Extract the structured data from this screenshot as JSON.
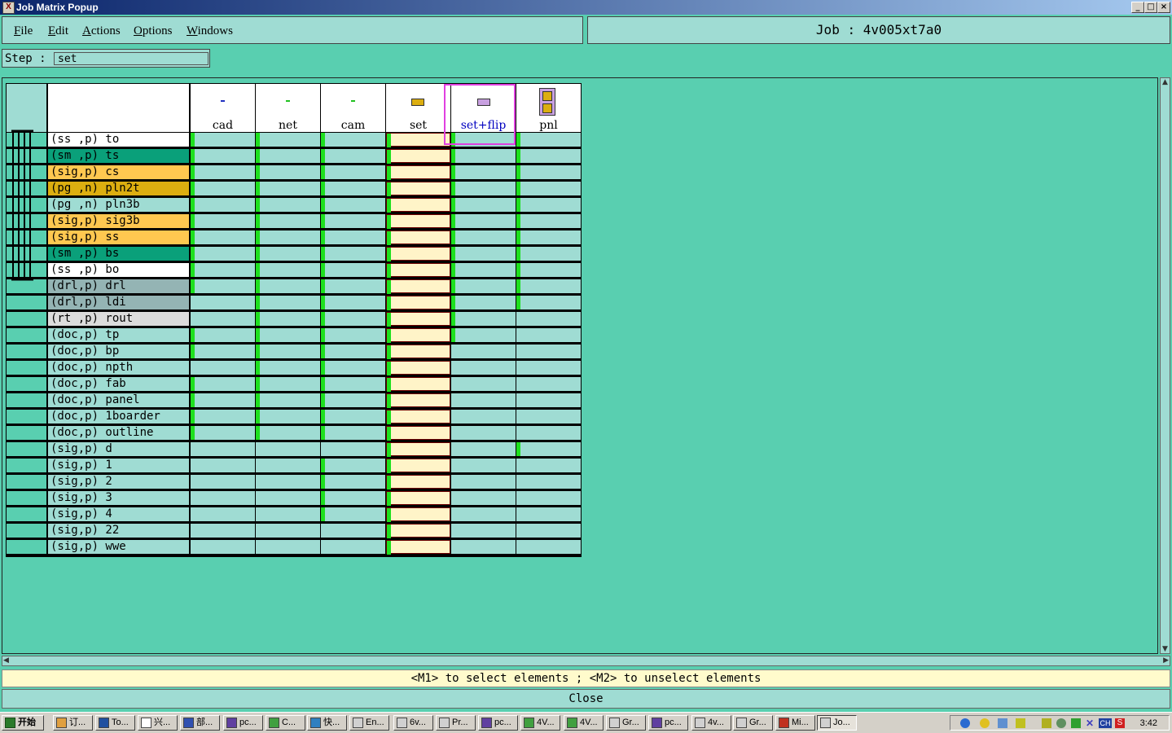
{
  "window": {
    "title": "Job Matrix Popup",
    "minimize": "_",
    "maximize": "□",
    "close": "×"
  },
  "menu": [
    "File",
    "Edit",
    "Actions",
    "Options",
    "Windows"
  ],
  "job": {
    "label": "Job",
    "sep": ":",
    "name": "4v005xt7a0"
  },
  "step": {
    "label": "Step :",
    "value": "set"
  },
  "columns": [
    {
      "name": "cad",
      "icon": "cad-step-icon"
    },
    {
      "name": "net",
      "icon": "net-step-icon"
    },
    {
      "name": "cam",
      "icon": "cam-step-icon"
    },
    {
      "name": "set",
      "icon": "set-step-icon"
    },
    {
      "name": "set+flip",
      "icon": "set-flip-step-icon"
    },
    {
      "name": "pnl",
      "icon": "pnl-step-icon"
    }
  ],
  "rows": [
    {
      "label": "(ss ,p) to",
      "type": "silk",
      "cells": [
        1,
        1,
        1,
        1,
        1,
        1
      ]
    },
    {
      "label": "(sm ,p) ts",
      "type": "mask",
      "cells": [
        1,
        1,
        1,
        1,
        1,
        1
      ]
    },
    {
      "label": "(sig,p) cs",
      "type": "signal",
      "cells": [
        1,
        1,
        1,
        1,
        1,
        1
      ]
    },
    {
      "label": "(pg ,n) pln2t",
      "type": "plane",
      "cells": [
        1,
        1,
        1,
        1,
        1,
        1
      ]
    },
    {
      "label": "(pg ,n) pln3b",
      "type": "plain",
      "cells": [
        1,
        1,
        1,
        1,
        1,
        1
      ]
    },
    {
      "label": "(sig,p) sig3b",
      "type": "signal",
      "cells": [
        1,
        1,
        1,
        1,
        1,
        1
      ]
    },
    {
      "label": "(sig,p) ss",
      "type": "signal",
      "cells": [
        1,
        1,
        1,
        1,
        1,
        1
      ]
    },
    {
      "label": "(sm ,p) bs",
      "type": "mask",
      "cells": [
        1,
        1,
        1,
        1,
        1,
        1
      ]
    },
    {
      "label": "(ss ,p) bo",
      "type": "silk",
      "cells": [
        1,
        1,
        1,
        1,
        1,
        1
      ]
    },
    {
      "label": "(drl,p) drl",
      "type": "drill",
      "cells": [
        1,
        1,
        1,
        1,
        1,
        1
      ]
    },
    {
      "label": "(drl,p) ldi",
      "type": "drill",
      "cells": [
        0,
        1,
        1,
        1,
        1,
        1
      ]
    },
    {
      "label": "(rt ,p) rout",
      "type": "rout",
      "cells": [
        0,
        1,
        1,
        1,
        1,
        0
      ]
    },
    {
      "label": "(doc,p) tp",
      "type": "plain",
      "cells": [
        1,
        1,
        1,
        1,
        1,
        0
      ]
    },
    {
      "label": "(doc,p) bp",
      "type": "plain",
      "cells": [
        1,
        1,
        1,
        1,
        0,
        0
      ]
    },
    {
      "label": "(doc,p) npth",
      "type": "plain",
      "cells": [
        0,
        1,
        1,
        1,
        0,
        0
      ]
    },
    {
      "label": "(doc,p) fab",
      "type": "plain",
      "cells": [
        1,
        1,
        1,
        1,
        0,
        0
      ]
    },
    {
      "label": "(doc,p) panel",
      "type": "plain",
      "cells": [
        1,
        1,
        1,
        1,
        0,
        0
      ]
    },
    {
      "label": "(doc,p) 1boarder",
      "type": "plain",
      "cells": [
        1,
        1,
        1,
        1,
        0,
        0
      ]
    },
    {
      "label": "(doc,p) outline",
      "type": "plain",
      "cells": [
        1,
        1,
        1,
        1,
        0,
        0
      ]
    },
    {
      "label": "(sig,p) d",
      "type": "plain",
      "cells": [
        0,
        0,
        0,
        1,
        0,
        1
      ]
    },
    {
      "label": "(sig,p) 1",
      "type": "plain",
      "cells": [
        0,
        0,
        1,
        1,
        0,
        0
      ]
    },
    {
      "label": "(sig,p) 2",
      "type": "plain",
      "cells": [
        0,
        0,
        1,
        1,
        0,
        0
      ]
    },
    {
      "label": "(sig,p) 3",
      "type": "plain",
      "cells": [
        0,
        0,
        1,
        1,
        0,
        0
      ]
    },
    {
      "label": "(sig,p) 4",
      "type": "plain",
      "cells": [
        0,
        0,
        1,
        1,
        0,
        0
      ]
    },
    {
      "label": "(sig,p) 22",
      "type": "plain",
      "cells": [
        0,
        0,
        0,
        1,
        0,
        0
      ]
    },
    {
      "label": "(sig,p) wwe",
      "type": "plain",
      "cells": [
        0,
        0,
        0,
        1,
        0,
        0
      ]
    }
  ],
  "colors": {
    "silk": "#ffffff",
    "mask": "#0aa07a",
    "signal": "#ffc850",
    "plane": "#dcae10",
    "drill": "#94b4b4",
    "rout": "#dcdcdc",
    "plain": "#9fdcd3",
    "active": "#1ee01e",
    "grid": "#9fdcd3",
    "set": "#fff4c8",
    "selection": "#e040e0"
  },
  "status": "<M1> to select elements ; <M2> to unselect elements",
  "close_label": "Close",
  "taskbar": {
    "start": "开始",
    "items": [
      "订...",
      "To...",
      "兴...",
      "部...",
      "pc...",
      "C...",
      "快...",
      "En...",
      "6v...",
      "Pr...",
      "pc...",
      "4V...",
      "4V...",
      "Gr...",
      "pc...",
      "4v...",
      "Gr...",
      "Mi...",
      "Jo..."
    ],
    "lang": "CH",
    "clock": "3:42"
  }
}
